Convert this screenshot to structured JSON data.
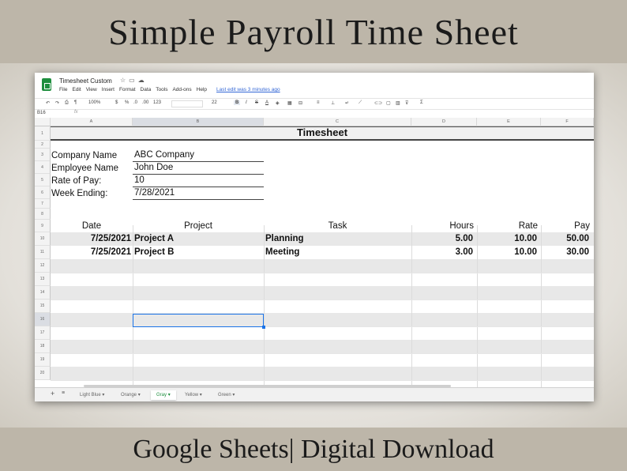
{
  "banner": {
    "top_text": "Simple Payroll Time Sheet",
    "bottom_text": "Google Sheets| Digital Download"
  },
  "app": {
    "doc_title": "Timesheet Custom",
    "menu": [
      "File",
      "Edit",
      "View",
      "Insert",
      "Format",
      "Data",
      "Tools",
      "Add-ons",
      "Help"
    ],
    "last_edit": "Last edit was 3 minutes ago"
  },
  "toolbar": {
    "zoom": "100%",
    "currency": "$",
    "percent": "%",
    "decimal_less": ".0",
    "decimal_more": ".00",
    "format_more": "123",
    "font_size": "22",
    "bold": "B",
    "italic": "I",
    "strike": "S",
    "text_color": "A"
  },
  "formula_bar": {
    "name_box": "B16",
    "fx": "fx"
  },
  "columns": [
    "A",
    "B",
    "C",
    "D",
    "E",
    "F"
  ],
  "rows": [
    "1",
    "2",
    "3",
    "4",
    "5",
    "6",
    "7",
    "8",
    "9",
    "10",
    "11",
    "12",
    "13",
    "14",
    "15",
    "16",
    "17",
    "18",
    "19",
    "20"
  ],
  "sheet": {
    "title": "Timesheet",
    "info_labels": [
      "Company Name",
      "Employee Name",
      "Rate of Pay:",
      "Week Ending:"
    ],
    "info_values": [
      "ABC  Company",
      "John Doe",
      "10",
      "7/28/2021"
    ],
    "headers": {
      "date": "Date",
      "project": "Project",
      "task": "Task",
      "hours": "Hours",
      "rate": "Rate",
      "pay": "Pay"
    },
    "entries": [
      {
        "date": "7/25/2021",
        "project": "Project A",
        "task": "Planning",
        "hours": "5.00",
        "rate": "10.00",
        "pay": "50.00"
      },
      {
        "date": "7/25/2021",
        "project": "Project B",
        "task": "Meeting",
        "hours": "3.00",
        "rate": "10.00",
        "pay": "30.00"
      }
    ]
  },
  "tabs": [
    {
      "label": "Light Blue",
      "active": false
    },
    {
      "label": "Orange",
      "active": false
    },
    {
      "label": "Gray",
      "active": true
    },
    {
      "label": "Yellow",
      "active": false
    },
    {
      "label": "Green",
      "active": false
    }
  ],
  "colors": {
    "accent": "#1a73e8",
    "sheets_green": "#1e8e3e",
    "row_band": "#e8e8e8",
    "banner": "#bdb6a9"
  }
}
